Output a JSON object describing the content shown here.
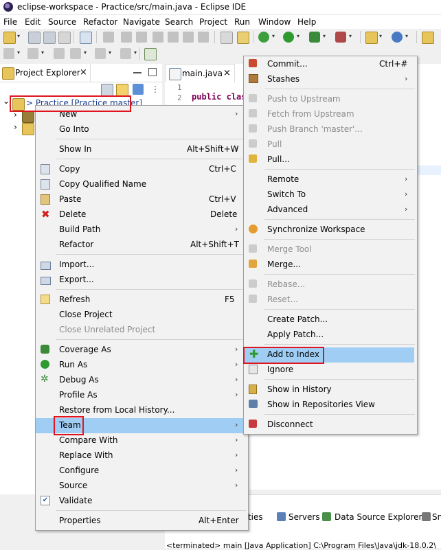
{
  "window": {
    "title": "eclipse-workspace - Practice/src/main.java - Eclipse IDE"
  },
  "menubar": [
    "File",
    "Edit",
    "Source",
    "Refactor",
    "Navigate",
    "Search",
    "Project",
    "Run",
    "Window",
    "Help"
  ],
  "project_explorer": {
    "tab_label": "Project Explorer",
    "close_glyph": "×",
    "project_node": "> Practice [Practice master]"
  },
  "editor": {
    "tab_label": "main.java",
    "close_glyph": "×",
    "line_numbers": [
      "1",
      "2"
    ],
    "code_line_2": "public clas"
  },
  "bottom_panel": {
    "tabs": [
      "rties",
      "Servers",
      "Data Source Explorer",
      "Sn"
    ],
    "console": "<terminated> main [Java Application] C:\\Program Files\\Java\\jdk-18.0.2\\"
  },
  "context_menu": {
    "items": [
      {
        "label": "New",
        "submenu": true
      },
      {
        "label": "Go Into"
      },
      {
        "label": "Show In",
        "shortcut": "Alt+Shift+W",
        "submenu": true
      },
      {
        "label": "Copy",
        "shortcut": "Ctrl+C"
      },
      {
        "label": "Copy Qualified Name"
      },
      {
        "label": "Paste",
        "shortcut": "Ctrl+V"
      },
      {
        "label": "Delete",
        "shortcut": "Delete"
      },
      {
        "label": "Build Path",
        "submenu": true
      },
      {
        "label": "Refactor",
        "shortcut": "Alt+Shift+T",
        "submenu": true
      },
      {
        "label": "Import..."
      },
      {
        "label": "Export..."
      },
      {
        "label": "Refresh",
        "shortcut": "F5"
      },
      {
        "label": "Close Project"
      },
      {
        "label": "Close Unrelated Project",
        "disabled": true
      },
      {
        "label": "Coverage As",
        "submenu": true
      },
      {
        "label": "Run As",
        "submenu": true
      },
      {
        "label": "Debug As",
        "submenu": true
      },
      {
        "label": "Profile As",
        "submenu": true
      },
      {
        "label": "Restore from Local History..."
      },
      {
        "label": "Team",
        "submenu": true,
        "highlighted": true
      },
      {
        "label": "Compare With",
        "submenu": true
      },
      {
        "label": "Replace With",
        "submenu": true
      },
      {
        "label": "Configure",
        "submenu": true
      },
      {
        "label": "Source",
        "submenu": true
      },
      {
        "label": "Validate"
      },
      {
        "label": "Properties",
        "shortcut": "Alt+Enter"
      }
    ]
  },
  "team_menu": {
    "items": [
      {
        "label": "Commit...",
        "shortcut": "Ctrl+#"
      },
      {
        "label": "Stashes",
        "submenu": true
      },
      {
        "label": "Push to Upstream",
        "disabled": true
      },
      {
        "label": "Fetch from Upstream",
        "disabled": true
      },
      {
        "label": "Push Branch 'master'...",
        "disabled": true
      },
      {
        "label": "Pull",
        "disabled": true
      },
      {
        "label": "Pull..."
      },
      {
        "label": "Remote",
        "submenu": true
      },
      {
        "label": "Switch To",
        "submenu": true
      },
      {
        "label": "Advanced",
        "submenu": true
      },
      {
        "label": "Synchronize Workspace"
      },
      {
        "label": "Merge Tool",
        "disabled": true
      },
      {
        "label": "Merge..."
      },
      {
        "label": "Rebase...",
        "disabled": true
      },
      {
        "label": "Reset...",
        "disabled": true
      },
      {
        "label": "Create Patch..."
      },
      {
        "label": "Apply Patch..."
      },
      {
        "label": "Add to Index",
        "highlighted": true
      },
      {
        "label": "Ignore"
      },
      {
        "label": "Show in History"
      },
      {
        "label": "Show in Repositories View"
      },
      {
        "label": "Disconnect"
      }
    ]
  },
  "glyphs": {
    "submenu_arrow": "›",
    "tree_expanded": "⌄",
    "tree_collapsed": "›",
    "dropdown": "▾",
    "check": "✔"
  },
  "colors": {
    "highlight": "#9fcdf4",
    "annotation_red": "#e0141e",
    "keyword": "#7f0055",
    "disabled_text": "#8d8d8d"
  }
}
